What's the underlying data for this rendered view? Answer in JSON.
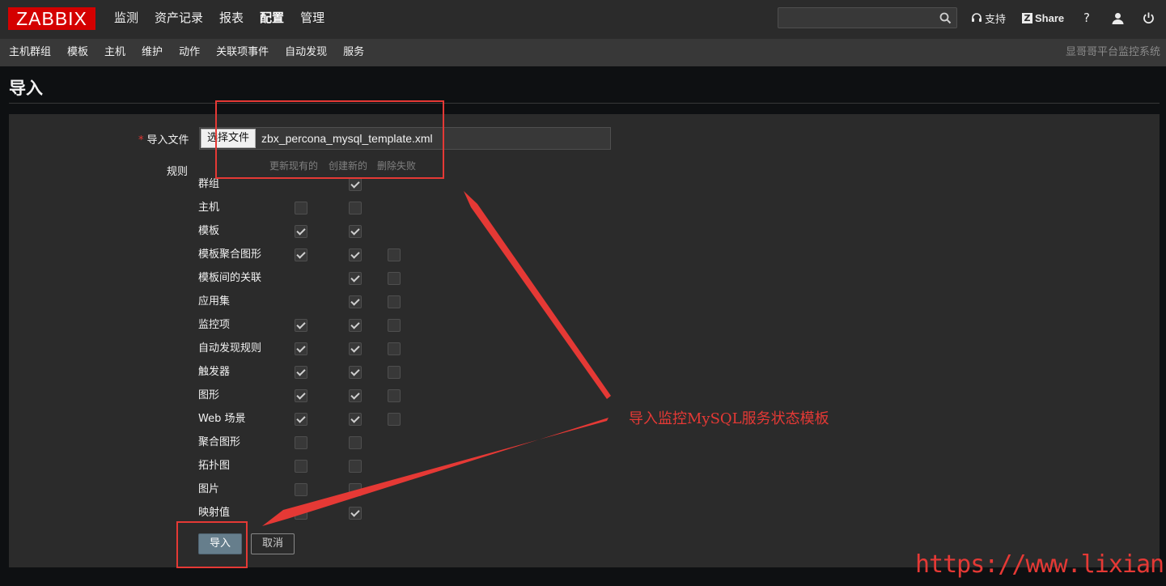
{
  "app": {
    "logo": "ZABBIX"
  },
  "topnav": {
    "items": [
      "监测",
      "资产记录",
      "报表",
      "配置",
      "管理"
    ],
    "active": "配置",
    "search_value": "",
    "support_label": "支持",
    "share_label": "Share",
    "help_label": "?"
  },
  "subnav": {
    "items": [
      "主机群组",
      "模板",
      "主机",
      "维护",
      "动作",
      "关联项事件",
      "自动发现",
      "服务"
    ],
    "right_text": "显哥哥平台监控系统"
  },
  "page": {
    "title": "导入"
  },
  "form": {
    "file_label": "导入文件",
    "file_button": "选择文件",
    "file_name": "zbx_percona_mysql_template.xml",
    "rules_label": "规则",
    "column_headers": [
      "更新现有的",
      "创建新的",
      "删除失败"
    ],
    "rules": [
      {
        "name": "群组",
        "update": null,
        "create": true,
        "delete": null
      },
      {
        "name": "主机",
        "update": false,
        "create": false,
        "delete": null
      },
      {
        "name": "模板",
        "update": true,
        "create": true,
        "delete": null
      },
      {
        "name": "模板聚合图形",
        "update": true,
        "create": true,
        "delete": false
      },
      {
        "name": "模板间的关联",
        "update": null,
        "create": true,
        "delete": false
      },
      {
        "name": "应用集",
        "update": null,
        "create": true,
        "delete": false
      },
      {
        "name": "监控项",
        "update": true,
        "create": true,
        "delete": false
      },
      {
        "name": "自动发现规则",
        "update": true,
        "create": true,
        "delete": false
      },
      {
        "name": "触发器",
        "update": true,
        "create": true,
        "delete": false
      },
      {
        "name": "图形",
        "update": true,
        "create": true,
        "delete": false
      },
      {
        "name": "Web 场景",
        "update": true,
        "create": true,
        "delete": false
      },
      {
        "name": "聚合图形",
        "update": false,
        "create": false,
        "delete": null
      },
      {
        "name": "拓扑图",
        "update": false,
        "create": false,
        "delete": null
      },
      {
        "name": "图片",
        "update": false,
        "create": false,
        "delete": null
      },
      {
        "name": "映射值",
        "update": false,
        "create": true,
        "delete": null
      }
    ],
    "import_button": "导入",
    "cancel_button": "取消"
  },
  "annotation": {
    "text": "导入监控MySQL服务状态模板",
    "color": "#e53935"
  },
  "watermark": "https://www.lixian.fun",
  "colors": {
    "topbar": "#2b2b2b",
    "subbar": "#383838",
    "logo_bg": "#d40000",
    "panel": "#2b2b2b",
    "primary_button": "#667e8c"
  }
}
